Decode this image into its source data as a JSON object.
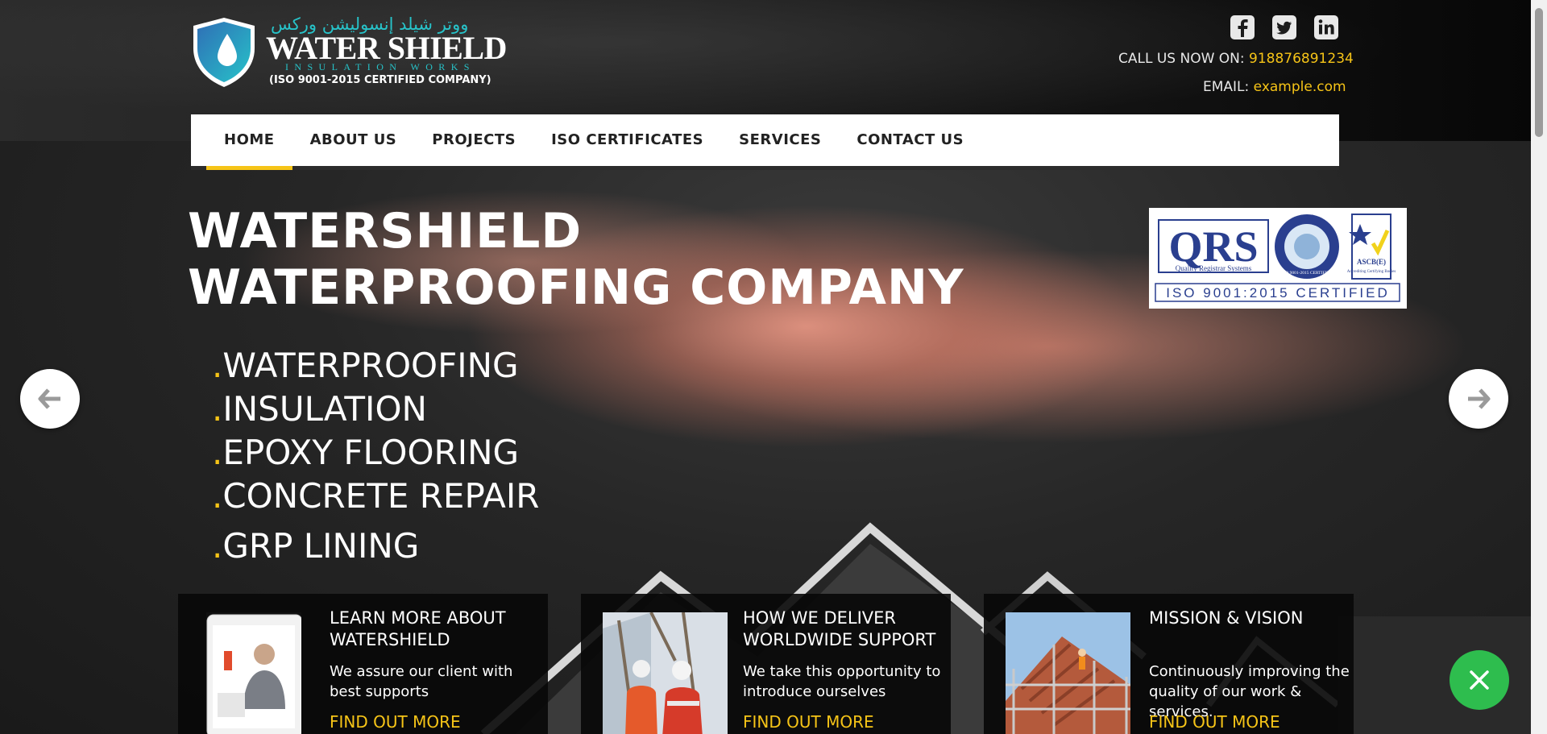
{
  "header": {
    "logo": {
      "arabic": "ووتر شيلد إنسوليشن وركس",
      "name": "WATER SHIELD",
      "tagline": "INSULATION WORKS",
      "certification": "(ISO 9001-2015  CERTIFIED COMPANY)"
    },
    "social": [
      "facebook-icon",
      "twitter-icon",
      "linkedin-icon"
    ],
    "phone_label": "CALL US NOW ON:",
    "phone": "918876891234",
    "email_label": "EMAIL:",
    "email": "example.com"
  },
  "nav": {
    "items": [
      {
        "label": "HOME",
        "active": true
      },
      {
        "label": "ABOUT US"
      },
      {
        "label": "PROJECTS"
      },
      {
        "label": "ISO CERTIFICATES"
      },
      {
        "label": "SERVICES"
      },
      {
        "label": "CONTACT US"
      }
    ]
  },
  "hero": {
    "title_line1": "WATERSHIELD",
    "title_line2": "WATERPROOFING COMPANY",
    "services": [
      "WATERPROOFING",
      "INSULATION",
      "EPOXY FLOORING",
      "CONCRETE REPAIR",
      "GRP LINING"
    ],
    "cert": {
      "qrs": "QRS",
      "qrs_caption": "Quality Registrar Systems",
      "seal_top": "QRS",
      "seal_ring": "ISO 9001-2015 CERTIFIED",
      "ascb": "ASCB(E)",
      "ascb_caption": "Accrediting Certifying Bodies",
      "banner": "ISO 9001:2015 CERTIFIED"
    }
  },
  "cards": [
    {
      "title": "LEARN MORE ABOUT WATERSHIELD",
      "text": "We assure our client with best supports",
      "link": "FIND OUT MORE"
    },
    {
      "title": "HOW WE DELIVER WORLDWIDE SUPPORT",
      "text": "We take this opportunity to introduce ourselves",
      "link": "FIND OUT MORE"
    },
    {
      "title": "MISSION & VISION",
      "text": "Continuously improving the quality of our work & services.",
      "link": "FIND OUT MORE"
    }
  ],
  "colors": {
    "accent": "#f6c417",
    "teal": "#27c3c9",
    "whatsapp": "#2ebd4e"
  }
}
